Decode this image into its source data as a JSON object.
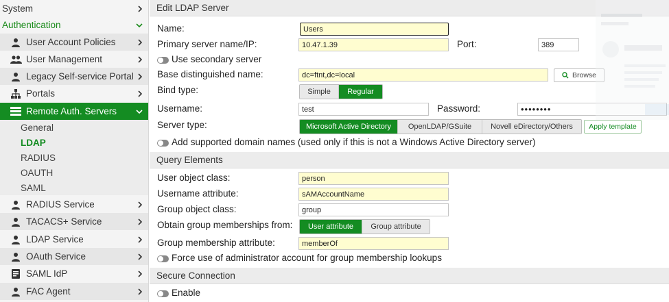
{
  "sidebar": {
    "system": "System",
    "authentication": "Authentication",
    "items_top": [
      {
        "label": "User Account Policies",
        "icon": "user-icon"
      },
      {
        "label": "User Management",
        "icon": "users-icon"
      },
      {
        "label": "Legacy Self-service Portal",
        "icon": "user-icon"
      },
      {
        "label": "Portals",
        "icon": "sitemap-icon"
      }
    ],
    "remote_auth": "Remote Auth. Servers",
    "sub_items": [
      "General",
      "LDAP",
      "RADIUS",
      "OAUTH",
      "SAML"
    ],
    "items_bottom": [
      {
        "label": "RADIUS Service",
        "icon": "user-icon"
      },
      {
        "label": "TACACS+ Service",
        "icon": "user-icon"
      },
      {
        "label": "LDAP Service",
        "icon": "user-icon"
      },
      {
        "label": "OAuth Service",
        "icon": "user-icon"
      },
      {
        "label": "SAML IdP",
        "icon": "id-card-icon"
      },
      {
        "label": "FAC Agent",
        "icon": "user-icon"
      }
    ]
  },
  "form": {
    "header": "Edit LDAP Server",
    "name_label": "Name:",
    "name_value": "Users",
    "server_label": "Primary server name/IP:",
    "server_value": "10.47.1.39",
    "port_label": "Port:",
    "port_value": "389",
    "secondary_label": "Use secondary server",
    "basedn_label": "Base distinguished name:",
    "basedn_value": "dc=ftnt,dc=local",
    "browse_label": "Browse",
    "bind_label": "Bind type:",
    "bind_options": [
      "Simple",
      "Regular"
    ],
    "username_label": "Username:",
    "username_value": "test",
    "password_label": "Password:",
    "password_value": "••••••••",
    "server_type_label": "Server type:",
    "server_types": [
      "Microsoft Active Directory",
      "OpenLDAP/GSuite",
      "Novell eDirectory/Others"
    ],
    "apply_template": "Apply template",
    "domain_names_label": "Add supported domain names (used only if this is not a Windows Active Directory server)"
  },
  "query": {
    "header": "Query Elements",
    "user_class_label": "User object class:",
    "user_class_value": "person",
    "username_attr_label": "Username attribute:",
    "username_attr_value": "sAMAccountName",
    "group_class_label": "Group object class:",
    "group_class_value": "group",
    "obtain_label": "Obtain group memberships from:",
    "obtain_options": [
      "User attribute",
      "Group attribute"
    ],
    "membership_attr_label": "Group membership attribute:",
    "membership_attr_value": "memberOf",
    "force_admin_label": "Force use of administrator account for group membership lookups"
  },
  "secure": {
    "header": "Secure Connection",
    "enable_label": "Enable"
  },
  "colors": {
    "accent": "#148c22",
    "field_highlight": "#fffdd0"
  }
}
